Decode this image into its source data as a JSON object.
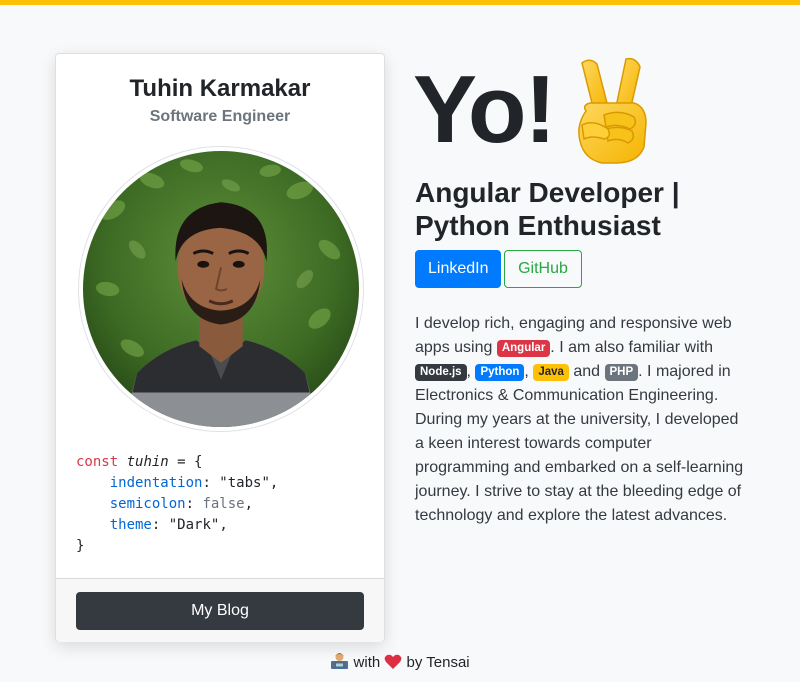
{
  "profile": {
    "name": "Tuhin Karmakar",
    "role": "Software Engineer"
  },
  "code": {
    "kw": "const",
    "var": "tuhin",
    "open": " = {",
    "lines": [
      {
        "key": "indentation",
        "value": "\"tabs\""
      },
      {
        "key": "semicolon",
        "value": "false"
      },
      {
        "key": "theme",
        "value": "\"Dark\""
      }
    ],
    "close": "}"
  },
  "blog_button": "My Blog",
  "hero": {
    "greeting": "Yo!",
    "emoji": "peace-hand-icon",
    "headline": "Angular Developer | Python Enthusiast"
  },
  "links": {
    "linkedin": "LinkedIn",
    "github": "GitHub"
  },
  "bio": {
    "t1": "I develop rich, engaging and responsive web apps using ",
    "angular": "Angular",
    "t2": ". I am also familiar with ",
    "nodejs": "Node.js",
    "comma1": ", ",
    "python": "Python",
    "comma2": ", ",
    "java": "Java",
    "and": " and ",
    "php": "PHP",
    "t3": ". I majored in Electronics & Communication Engineering. During my years at the university, I developed a keen interest towards computer programming and embarked on a self-learning journey. I strive to stay at the bleeding edge of technology and explore the latest advances."
  },
  "footer": {
    "with": " with ",
    "by": " by Tensai",
    "icons": [
      "technologist-icon",
      "heart-icon"
    ]
  },
  "colors": {
    "accent": "#ffc107",
    "primary": "#007bff",
    "success": "#28a745",
    "dark": "#343a40",
    "danger": "#dc3545"
  }
}
